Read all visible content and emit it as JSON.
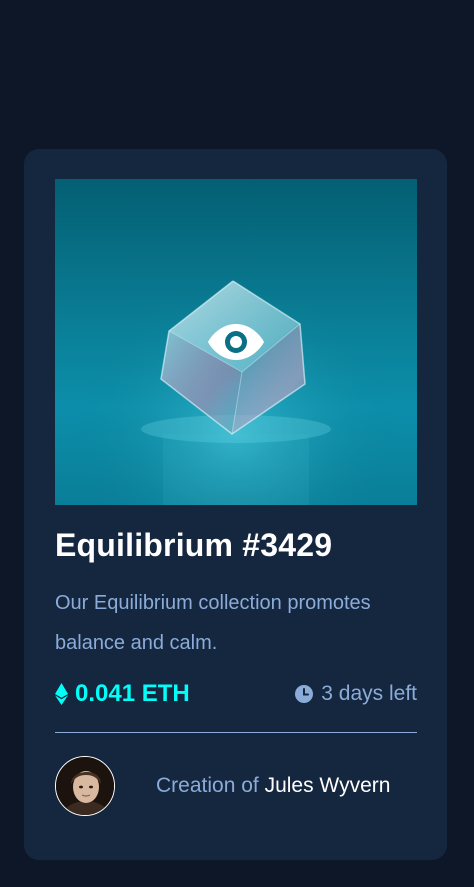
{
  "card": {
    "title": "Equilibrium #3429",
    "description": "Our Equilibrium collection promotes balance and calm.",
    "price": {
      "value": "0.041 ETH",
      "icon": "ethereum-icon"
    },
    "time_left": {
      "value": "3 days left",
      "icon": "clock-icon"
    },
    "creator": {
      "prefix": "Creation of",
      "name": "Jules Wyvern"
    },
    "image_overlay_icon": "eye-icon"
  },
  "colors": {
    "page_bg": "#0d1728",
    "card_bg": "#15263f",
    "accent_cyan": "#00fff8",
    "soft_blue": "#8bacd9",
    "white": "#ffffff"
  }
}
